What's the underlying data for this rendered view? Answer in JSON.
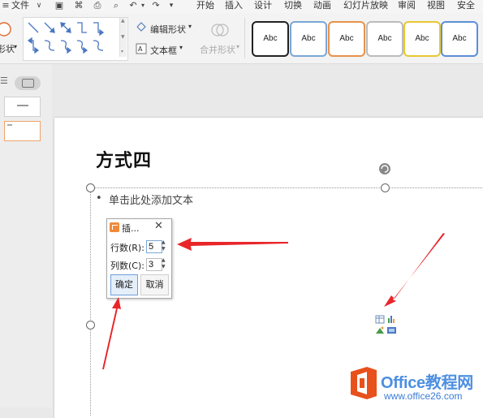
{
  "menubar": {
    "file_label": "文件",
    "tabs": [
      {
        "label": "开始"
      },
      {
        "label": "插入"
      },
      {
        "label": "设计"
      },
      {
        "label": "切换"
      },
      {
        "label": "动画"
      },
      {
        "label": "幻灯片放映"
      },
      {
        "label": "审阅"
      },
      {
        "label": "视图"
      },
      {
        "label": "安全"
      }
    ]
  },
  "ribbon": {
    "shape_fill_partial": "形状",
    "edit_shape_label": "编辑形状",
    "textbox_label": "文本框",
    "merge_shape_label": "合并形状",
    "style_boxes": [
      {
        "label": "Abc",
        "border": "#222222"
      },
      {
        "label": "Abc",
        "border": "#7aa7d6"
      },
      {
        "label": "Abc",
        "border": "#e8914a"
      },
      {
        "label": "Abc",
        "border": "#bbbbbb"
      },
      {
        "label": "Abc",
        "border": "#e8c832"
      },
      {
        "label": "Abc",
        "border": "#5b8fd6"
      }
    ]
  },
  "slide": {
    "title": "方式四",
    "placeholder": "单击此处添加文本"
  },
  "dialog": {
    "title": "插...",
    "rows_label": "行数(R):",
    "rows_value": "5",
    "cols_label": "列数(C):",
    "cols_value": "3",
    "ok_label": "确定",
    "cancel_label": "取消"
  },
  "watermark": {
    "brand": "Office教程网",
    "url": "www.office26.com"
  },
  "colors": {
    "arrow_red": "#e8262a",
    "selection_border": "#f0a36b",
    "watermark_blue": "#4d8fe1",
    "logo_orange": "#e8501c"
  }
}
